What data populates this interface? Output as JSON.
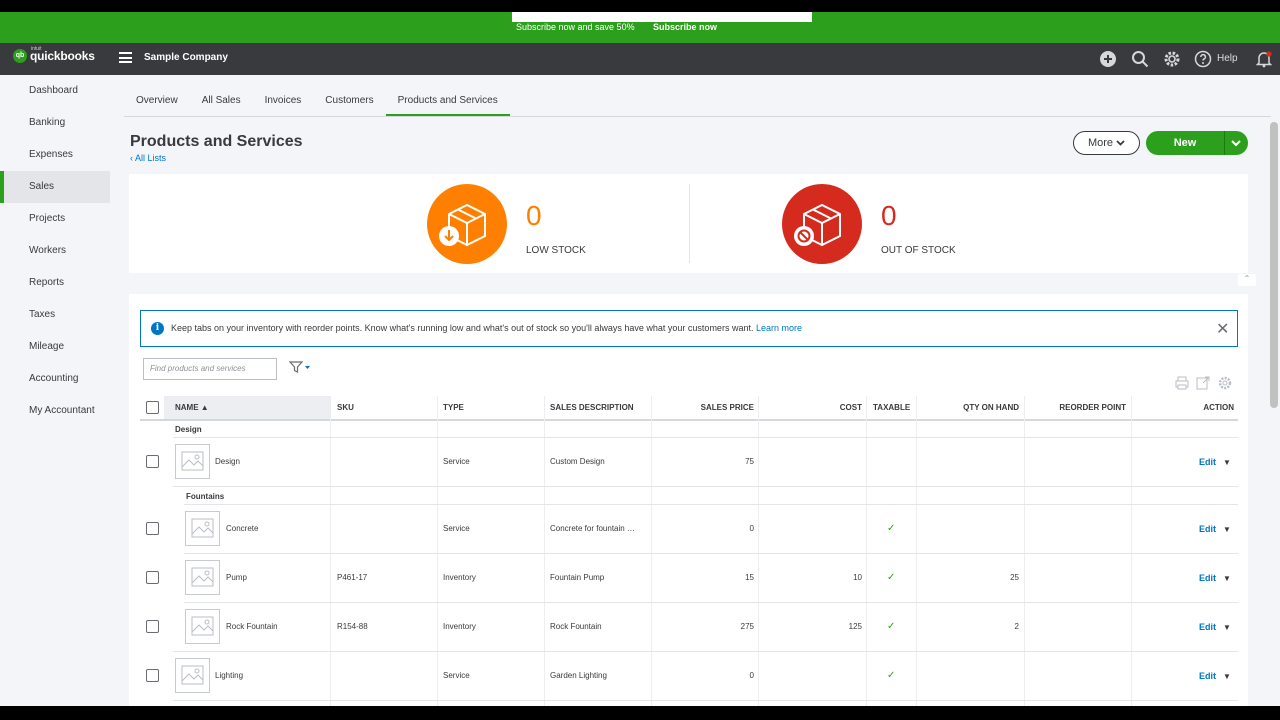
{
  "promo": {
    "text": "Subscribe now and save 50%",
    "button": "Subscribe now"
  },
  "topnav": {
    "brand": "quickbooks",
    "brand_prefix": "intuit",
    "brand_icon": "qb",
    "company": "Sample Company",
    "help": "Help"
  },
  "sidebar": {
    "items": [
      {
        "label": "Dashboard"
      },
      {
        "label": "Banking"
      },
      {
        "label": "Expenses"
      },
      {
        "label": "Sales"
      },
      {
        "label": "Projects"
      },
      {
        "label": "Workers"
      },
      {
        "label": "Reports"
      },
      {
        "label": "Taxes"
      },
      {
        "label": "Mileage"
      },
      {
        "label": "Accounting"
      },
      {
        "label": "My Accountant"
      }
    ],
    "active": "Sales"
  },
  "tabs": [
    "Overview",
    "All Sales",
    "Invoices",
    "Customers",
    "Products and Services"
  ],
  "page": {
    "title": "Products and Services",
    "back_link": "All Lists",
    "more": "More",
    "new": "New"
  },
  "stock": {
    "low": {
      "count": "0",
      "label": "LOW STOCK",
      "color": "#ff8000"
    },
    "out": {
      "count": "0",
      "label": "OUT OF STOCK",
      "color": "#d52b1e"
    }
  },
  "info": {
    "icon": "i",
    "close": "✕",
    "message": "Keep tabs on your inventory with reorder points. Know what's running low and what's out of stock so you'll always have what your customers want.",
    "link": "Learn more"
  },
  "search": {
    "placeholder": "Find products and services"
  },
  "table": {
    "columns": {
      "name": "NAME ▲",
      "sku": "SKU",
      "type": "TYPE",
      "desc": "SALES DESCRIPTION",
      "price": "SALES PRICE",
      "cost": "COST",
      "taxable": "TAXABLE",
      "qty": "QTY ON HAND",
      "reorder": "REORDER POINT",
      "action": "ACTION"
    },
    "groups": {
      "design": "Design",
      "fountains": "Fountains"
    },
    "rows": [
      {
        "name": "Design",
        "sku": "",
        "type": "Service",
        "desc": "Custom Design",
        "price": "75",
        "cost": "",
        "taxable": "",
        "qty": "",
        "action": "Edit"
      },
      {
        "name": "Concrete",
        "sku": "",
        "type": "Service",
        "desc": "Concrete for fountain …",
        "price": "0",
        "cost": "",
        "taxable": "✓",
        "qty": "",
        "action": "Edit"
      },
      {
        "name": "Pump",
        "sku": "P461-17",
        "type": "Inventory",
        "desc": "Fountain Pump",
        "price": "15",
        "cost": "10",
        "taxable": "✓",
        "qty": "25",
        "action": "Edit"
      },
      {
        "name": "Rock Fountain",
        "sku": "R154-88",
        "type": "Inventory",
        "desc": "Rock Fountain",
        "price": "275",
        "cost": "125",
        "taxable": "✓",
        "qty": "2",
        "action": "Edit"
      },
      {
        "name": "Lighting",
        "sku": "",
        "type": "Service",
        "desc": "Garden Lighting",
        "price": "0",
        "cost": "",
        "taxable": "✓",
        "qty": "",
        "action": "Edit"
      }
    ]
  },
  "colors": {
    "green": "#2ca01c",
    "blue": "#0077c5",
    "dark": "#393a3d"
  }
}
